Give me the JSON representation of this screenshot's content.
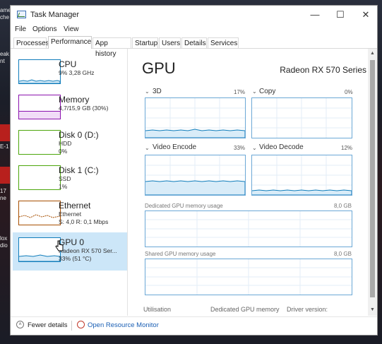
{
  "desktop": {
    "fragments": [
      "ame",
      "che",
      "eak",
      "nt",
      "E-1",
      "17",
      "ne",
      "lox",
      "dio"
    ]
  },
  "window": {
    "title": "Task Manager",
    "controls": {
      "minimize": "—",
      "maximize": "☐",
      "close": "✕"
    }
  },
  "menu": [
    "File",
    "Options",
    "View"
  ],
  "tabs": [
    "Processes",
    "Performance",
    "App history",
    "Startup",
    "Users",
    "Details",
    "Services"
  ],
  "active_tab": "Performance",
  "sidebar": {
    "items": [
      {
        "name": "CPU",
        "line1": "9% 3,28 GHz",
        "line2": "",
        "color": "#117dbb"
      },
      {
        "name": "Memory",
        "line1": "4,7/15,9 GB (30%)",
        "line2": "",
        "color": "#8b12ae"
      },
      {
        "name": "Disk 0 (D:)",
        "line1": "HDD",
        "line2": "0%",
        "color": "#4da60c"
      },
      {
        "name": "Disk 1 (C:)",
        "line1": "SSD",
        "line2": "1%",
        "color": "#4da60c"
      },
      {
        "name": "Ethernet",
        "line1": "Ethernet",
        "line2": "S: 4,0 R: 0,1 Mbps",
        "color": "#a74f01"
      },
      {
        "name": "GPU 0",
        "line1": "Radeon RX 570 Ser...",
        "line2": "33% (51 °C)",
        "color": "#117dbb"
      }
    ]
  },
  "main": {
    "title": "GPU",
    "device": "Radeon RX 570 Series",
    "engines": [
      {
        "label": "3D",
        "pct": "17%"
      },
      {
        "label": "Copy",
        "pct": "0%"
      },
      {
        "label": "Video Encode",
        "pct": "33%"
      },
      {
        "label": "Video Decode",
        "pct": "12%"
      }
    ],
    "dedicated_label": "Dedicated GPU memory usage",
    "dedicated_max": "8,0 GB",
    "shared_label": "Shared GPU memory usage",
    "shared_max": "8,0 GB",
    "stats": [
      "Utilisation",
      "Dedicated GPU memory",
      "Driver version:"
    ]
  },
  "footer": {
    "fewer_details": "Fewer details",
    "open_resource_monitor": "Open Resource Monitor"
  },
  "colors": {
    "accent": "#117dbb",
    "selection": "#cce6f8",
    "graph_border": "#6ba8d6",
    "link": "#1a5fb4"
  }
}
